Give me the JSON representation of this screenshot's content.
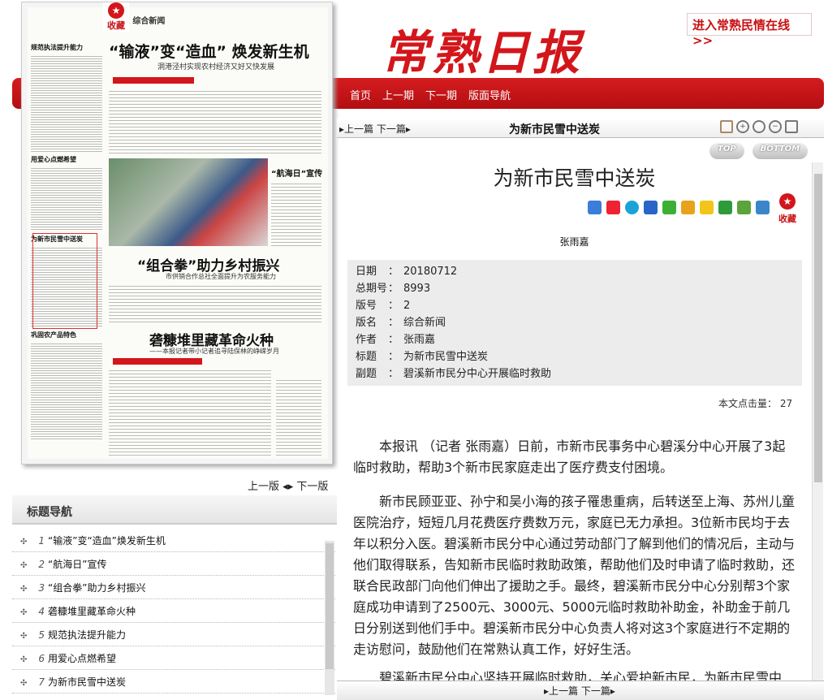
{
  "header": {
    "masthead": "常熟日报",
    "minqing_link": "进入常熟民情在线 >>",
    "nav": [
      "首页",
      "上一期",
      "下一期",
      "版面导航"
    ]
  },
  "paper": {
    "favorite": "收藏",
    "page_no": "02",
    "page_name": "综合新闻",
    "headlines": [
      {
        "title": "“输液”变“造血” 焕发新生机",
        "sub": "洞港泾村实现农村经济又好又快发展"
      },
      {
        "title": "“组合拳”助力乡村振兴",
        "sub": "市供销合作总社全面提升为农服务能力"
      },
      {
        "title": "砻糠堆里藏革命火种",
        "sub": "——本报记者带小记者追寻陆保林的峥嵘岁月"
      }
    ],
    "photo_caption": "“航海日”宣传",
    "left_col": [
      "规范执法提升能力",
      "用爱心点燃希望",
      "为新市民雪中送炭",
      "巩固农产品特色"
    ]
  },
  "pager": {
    "prev": "上一版",
    "next": "下一版"
  },
  "title_nav": {
    "title": "标题导航",
    "items": [
      {
        "num": "1",
        "text": "“输液”变“造血”焕发新生机"
      },
      {
        "num": "2",
        "text": "“航海日”宣传"
      },
      {
        "num": "3",
        "text": "“组合拳”助力乡村振兴"
      },
      {
        "num": "4",
        "text": "砻糠堆里藏革命火种"
      },
      {
        "num": "5",
        "text": "规范执法提升能力"
      },
      {
        "num": "6",
        "text": "用爱心点燃希望"
      },
      {
        "num": "7",
        "text": "为新市民雪中送炭"
      }
    ]
  },
  "article_bar": {
    "prev": "上一篇",
    "next": "下一篇",
    "title": "为新市民雪中送炭"
  },
  "top_buttons": {
    "top": "TOP",
    "bottom": "BOTTOM"
  },
  "article": {
    "title": "为新市民雪中送炭",
    "favorite": "收藏",
    "author": "张雨嘉",
    "meta": [
      {
        "k": "日期",
        "v": "20180712"
      },
      {
        "k": "总期号",
        "v": "8993"
      },
      {
        "k": "版号",
        "v": "2"
      },
      {
        "k": "版名",
        "v": "综合新闻"
      },
      {
        "k": "作者",
        "v": "张雨嘉"
      },
      {
        "k": "标题",
        "v": "为新市民雪中送炭"
      },
      {
        "k": "副题",
        "v": "碧溪新市民分中心开展临时救助"
      }
    ],
    "hits_label": "本文点击量：",
    "hits": "27",
    "paragraphs": [
      "本报讯 （记者 张雨嘉）日前，市新市民事务中心碧溪分中心开展了3起临时救助，帮助3个新市民家庭走出了医疗费支付困境。",
      "新市民顾亚亚、孙宁和吴小海的孩子罹患重病，后转送至上海、苏州儿童医院治疗，短短几月花费医疗费数万元，家庭已无力承担。3位新市民均于去年以积分入医。碧溪新市民分中心通过劳动部门了解到他们的情况后，主动与他们取得联系，告知新市民临时救助政策，帮助他们及时申请了临时救助，还联合民政部门向他们伸出了援助之手。最终，碧溪新市民分中心分别帮3个家庭成功申请到了2500元、3000元、5000元临时救助补助金，补助金于前几日分别送到他们手中。碧溪新市民分中心负责人将对这3个家庭进行不定期的走访慰问，鼓励他们在常熟认真工作，好好生活。",
      "碧溪新市民分中心坚持开展临时救助，关心爱护新市民，为新市民雪中"
    ]
  },
  "bottom_bar": {
    "prev": "上一篇",
    "next": "下一篇"
  }
}
